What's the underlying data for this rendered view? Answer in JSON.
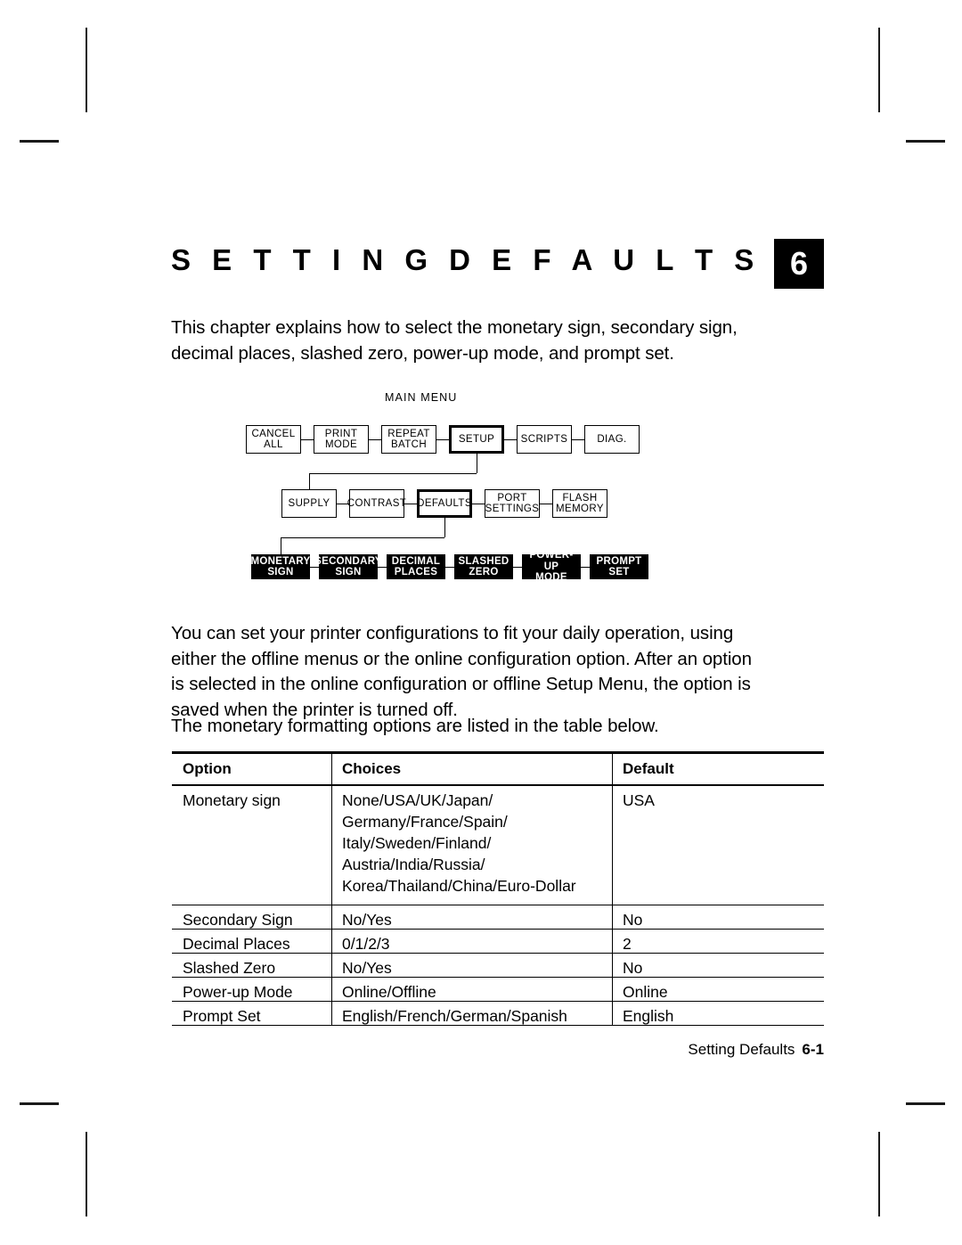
{
  "chapter": {
    "title": "S E T T I N G   D E F A U L T S",
    "number": "6"
  },
  "paragraphs": {
    "intro": "This chapter explains how to select the monetary sign, secondary sign, decimal places, slashed zero, power-up mode, and prompt set.",
    "config": "You can set your printer configurations to fit your daily operation, using either the offline menus or the online configuration option. After an option is selected in the online configuration or offline Setup Menu, the option is saved when the printer is turned off.",
    "table_intro": "The monetary formatting options are listed in the table below."
  },
  "menu_diagram": {
    "label": "MAIN MENU",
    "row1": [
      {
        "line1": "CANCEL",
        "line2": "ALL",
        "selected": false
      },
      {
        "line1": "PRINT",
        "line2": "MODE",
        "selected": false
      },
      {
        "line1": "REPEAT",
        "line2": "BATCH",
        "selected": false
      },
      {
        "line1": "SETUP",
        "line2": "",
        "selected": true
      },
      {
        "line1": "SCRIPTS",
        "line2": "",
        "selected": false
      },
      {
        "line1": "DIAG.",
        "line2": "",
        "selected": false
      }
    ],
    "row2": [
      {
        "line1": "SUPPLY",
        "line2": "",
        "selected": false
      },
      {
        "line1": "CONTRAST",
        "line2": "",
        "selected": false
      },
      {
        "line1": "DEFAULTS",
        "line2": "",
        "selected": true
      },
      {
        "line1": "PORT",
        "line2": "SETTINGS",
        "selected": false
      },
      {
        "line1": "FLASH",
        "line2": "MEMORY",
        "selected": false
      }
    ],
    "row3": [
      {
        "line1": "MONETARY",
        "line2": "SIGN"
      },
      {
        "line1": "SECONDARY",
        "line2": "SIGN"
      },
      {
        "line1": "DECIMAL",
        "line2": "PLACES"
      },
      {
        "line1": "SLASHED",
        "line2": "ZERO"
      },
      {
        "line1": "POWER-UP",
        "line2": "MODE"
      },
      {
        "line1": "PROMPT",
        "line2": "SET"
      }
    ]
  },
  "options_table": {
    "headers": [
      "Option",
      "Choices",
      "Default"
    ],
    "rows": [
      {
        "option": "Monetary sign",
        "choices": "None/USA/UK/Japan/\nGermany/France/Spain/\nItaly/Sweden/Finland/\nAustria/India/Russia/\nKorea/Thailand/China/Euro-Dollar",
        "default": "USA"
      },
      {
        "option": "Secondary Sign",
        "choices": "No/Yes",
        "default": "No"
      },
      {
        "option": "Decimal Places",
        "choices": "0/1/2/3",
        "default": "2"
      },
      {
        "option": "Slashed Zero",
        "choices": "No/Yes",
        "default": "No"
      },
      {
        "option": "Power-up Mode",
        "choices": "Online/Offline",
        "default": "Online"
      },
      {
        "option": "Prompt Set",
        "choices": "English/French/German/Spanish",
        "default": "English"
      }
    ]
  },
  "footer": {
    "chapter_name": "Setting Defaults",
    "page_number": "6-1"
  }
}
